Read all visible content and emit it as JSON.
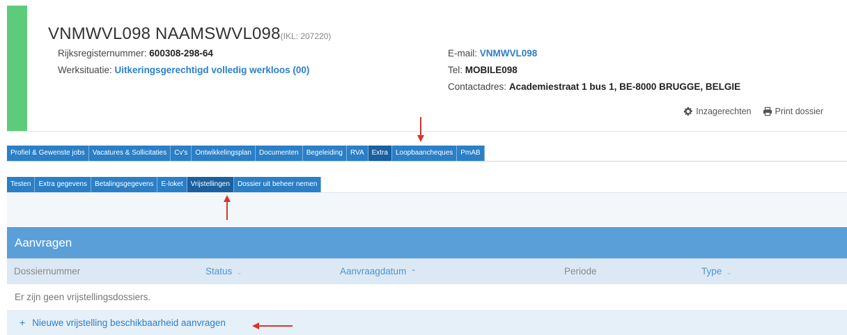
{
  "person": {
    "name": "VNMWVL098 NAAMSWVL098",
    "ikl": "(IKL: 207220)",
    "rijksregister_label": "Rijksregisternummer:",
    "rijksregister_value": "600308-298-64",
    "werksituatie_label": "Werksituatie:",
    "werksituatie_value": "Uitkeringsgerechtigd volledig werkloos (00)",
    "email_label": "E-mail:",
    "email_value": "VNMWVL098",
    "tel_label": "Tel:",
    "tel_value": "MOBILE098",
    "contact_label": "Contactadres:",
    "contact_value": "Academiestraat 1 bus 1, BE-8000 BRUGGE, BELGIE"
  },
  "header_actions": {
    "inzagerechten": "Inzagerechten",
    "print": "Print dossier",
    "inzagerechten_icon": "gear-icon",
    "print_icon": "printer-icon"
  },
  "main_tabs": [
    {
      "label": "Profiel & Gewenste jobs",
      "active": false
    },
    {
      "label": "Vacatures & Sollicitaties",
      "active": false
    },
    {
      "label": "Cv's",
      "active": false
    },
    {
      "label": "Ontwikkelingsplan",
      "active": false
    },
    {
      "label": "Documenten",
      "active": false
    },
    {
      "label": "Begeleiding",
      "active": false
    },
    {
      "label": "RVA",
      "active": false
    },
    {
      "label": "Extra",
      "active": true
    },
    {
      "label": "Loopbaancheques",
      "active": false
    },
    {
      "label": "PmAB",
      "active": false
    }
  ],
  "sub_tabs": [
    {
      "label": "Testen",
      "active": false
    },
    {
      "label": "Extra gegevens",
      "active": false
    },
    {
      "label": "Betalingsgegevens",
      "active": false
    },
    {
      "label": "E-loket",
      "active": false
    },
    {
      "label": "Vrijstellingen",
      "active": true
    },
    {
      "label": "Dossier uit beheer nemen",
      "active": false
    }
  ],
  "panel": {
    "title": "Aanvragen",
    "columns": {
      "dossiernummer": "Dossiernummer",
      "status": "Status",
      "aanvraagdatum": "Aanvraagdatum",
      "periode": "Periode",
      "type": "Type"
    },
    "empty_text": "Er zijn geen vrijstellingsdossiers.",
    "add_plus": "+",
    "add_label": "Nieuwe vrijstelling beschikbaarheid aanvragen"
  },
  "colors": {
    "accent_green": "#5dcc7a",
    "tab_blue": "#2a7fc7",
    "panel_blue": "#5b9fd8",
    "annotation_red": "#d9342b"
  }
}
